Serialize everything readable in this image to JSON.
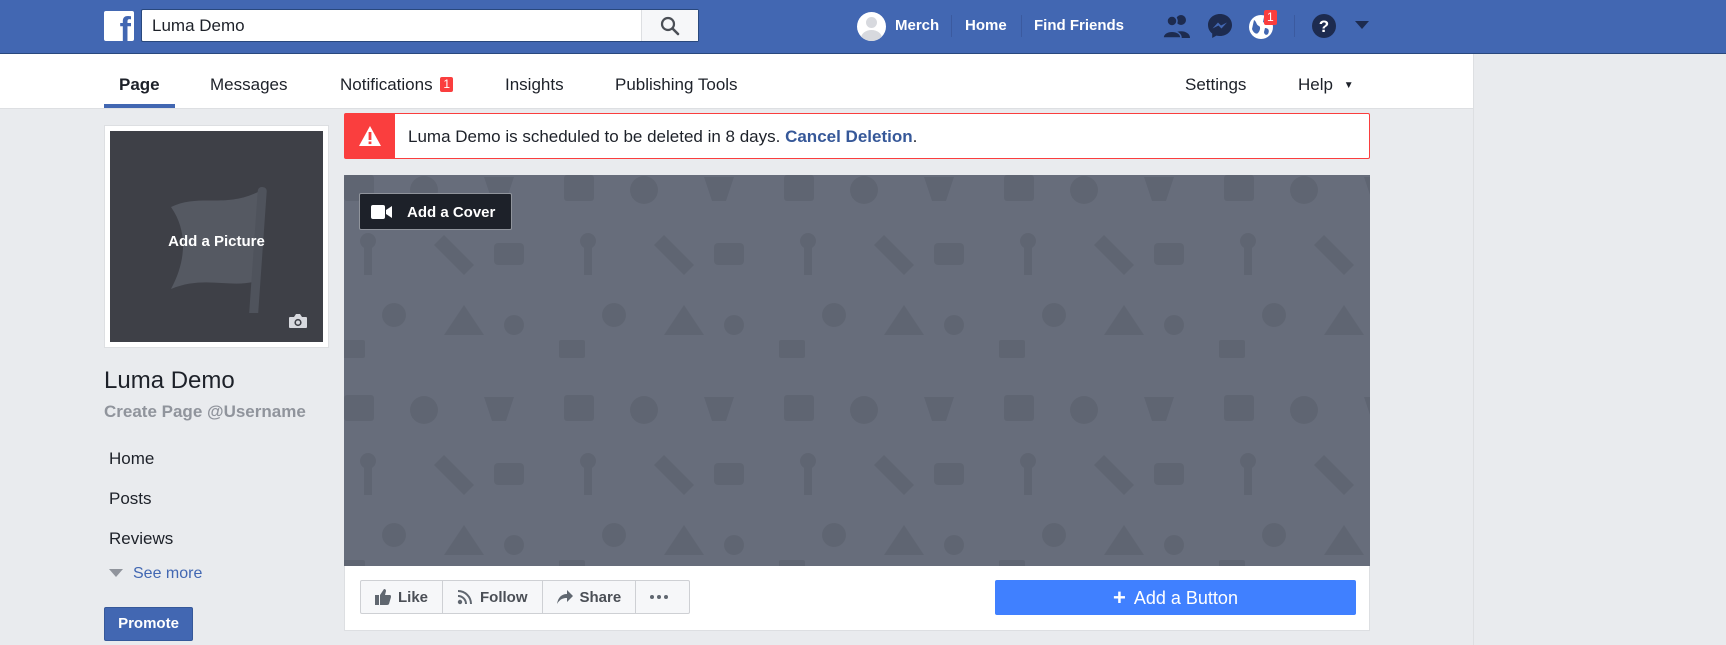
{
  "topbar": {
    "search_value": "Luma Demo",
    "search_placeholder": "Search",
    "user_name": "Merch",
    "home": "Home",
    "find_friends": "Find Friends",
    "notifications_badge": "1",
    "logo_letter": "f"
  },
  "subnav": {
    "tabs": [
      "Page",
      "Messages",
      "Notifications",
      "Insights",
      "Publishing Tools"
    ],
    "notifications_badge": "1",
    "settings": "Settings",
    "help": "Help"
  },
  "sidebar": {
    "add_picture": "Add a Picture",
    "page_name": "Luma Demo",
    "username_prompt": "Create Page @Username",
    "items": [
      "Home",
      "Posts",
      "Reviews"
    ],
    "see_more": "See more",
    "promote": "Promote"
  },
  "alert": {
    "message": "Luma Demo is scheduled to be deleted in 8 days.",
    "link": "Cancel Deletion",
    "suffix": "."
  },
  "cover": {
    "add_cover": "Add a Cover"
  },
  "actions": {
    "like": "Like",
    "follow": "Follow",
    "share": "Share",
    "add_button": "Add a Button"
  },
  "colors": {
    "brand": "#4267b2",
    "alert": "#fa3e3e",
    "cta": "#4080ff",
    "cover": "#676d7b"
  }
}
